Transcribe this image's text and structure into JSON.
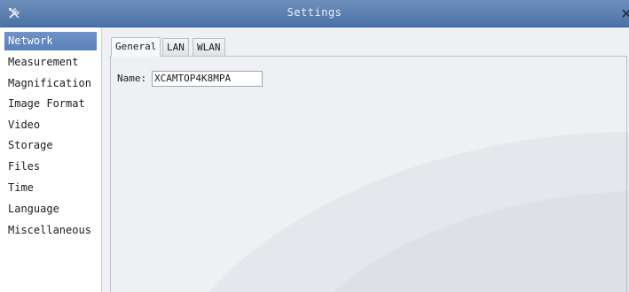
{
  "window": {
    "title": "Settings",
    "tools_icon": "tools-icon",
    "close_icon": "close-icon"
  },
  "sidebar": {
    "items": [
      {
        "label": "Network",
        "selected": true
      },
      {
        "label": "Measurement",
        "selected": false
      },
      {
        "label": "Magnification",
        "selected": false
      },
      {
        "label": "Image Format",
        "selected": false
      },
      {
        "label": "Video",
        "selected": false
      },
      {
        "label": "Storage",
        "selected": false
      },
      {
        "label": "Files",
        "selected": false
      },
      {
        "label": "Time",
        "selected": false
      },
      {
        "label": "Language",
        "selected": false
      },
      {
        "label": "Miscellaneous",
        "selected": false
      }
    ]
  },
  "tabs": [
    {
      "label": "General",
      "active": true
    },
    {
      "label": "LAN",
      "active": false
    },
    {
      "label": "WLAN",
      "active": false
    }
  ],
  "general": {
    "name_label": "Name:",
    "name_value": "XCAMTOP4K8MPA"
  },
  "colors": {
    "titlebar": "#5b7fb0",
    "selection": "#5a80ba",
    "panel_bg": "#eef0f3"
  }
}
